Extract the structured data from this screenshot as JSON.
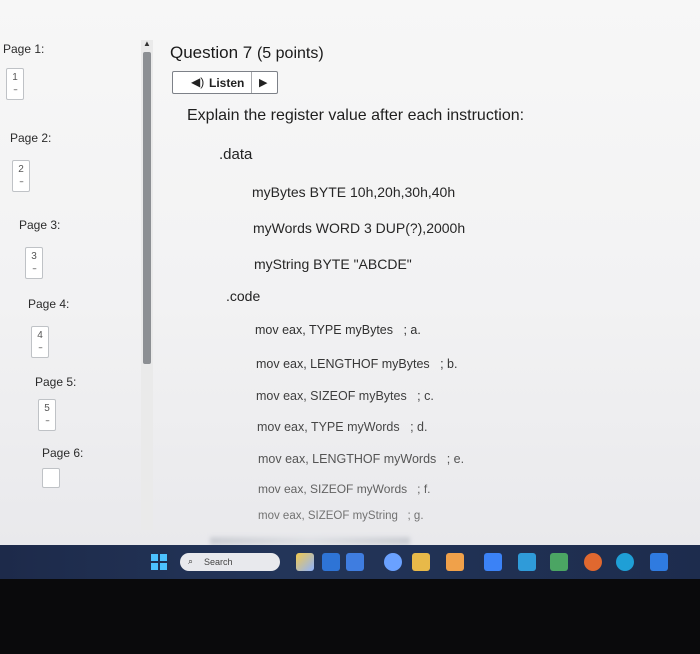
{
  "colors": {
    "accent": "#4cc2ff",
    "taskbar": "#1f2e50",
    "scrollbar_thumb": "#8c8f93"
  },
  "page_nav": {
    "pages": [
      {
        "label": "Page 1:",
        "number": "1",
        "marker": "--"
      },
      {
        "label": "Page 2:",
        "number": "2",
        "marker": "--"
      },
      {
        "label": "Page 3:",
        "number": "3",
        "marker": "--"
      },
      {
        "label": "Page 4:",
        "number": "4",
        "marker": "--"
      },
      {
        "label": "Page 5:",
        "number": "5",
        "marker": "--"
      },
      {
        "label": "Page 6:",
        "number": "",
        "marker": ""
      }
    ]
  },
  "question": {
    "title": "Question 7",
    "points": "(5 points)",
    "listen_label": "Listen",
    "instruction": "Explain the register value after each instruction:",
    "data_directive": ".data",
    "declarations": [
      "myBytes BYTE 10h,20h,30h,40h",
      "myWords WORD 3 DUP(?),2000h",
      "myString BYTE \"ABCDE\""
    ],
    "code_directive": ".code",
    "instructions": [
      {
        "text": "mov eax, TYPE myBytes",
        "comment": "; a."
      },
      {
        "text": "mov eax, LENGTHOF myBytes",
        "comment": "; b."
      },
      {
        "text": "mov eax, SIZEOF myBytes",
        "comment": "; c."
      },
      {
        "text": "mov eax, TYPE myWords",
        "comment": "; d."
      },
      {
        "text": "mov eax, LENGTHOF myWords",
        "comment": "; e."
      },
      {
        "text": "mov eax, SIZEOF myWords",
        "comment": "; f."
      },
      {
        "text": "mov eax, SIZEOF myString",
        "comment": "; g."
      }
    ]
  },
  "taskbar": {
    "search_placeholder": "Search",
    "icons": [
      "windows-start-icon",
      "weather-icon",
      "task-view-icon",
      "chat-icon",
      "file-explorer-icon",
      "store-icon",
      "app-icon",
      "word-icon",
      "mail-icon",
      "app-icon",
      "chrome-icon",
      "edge-icon",
      "app-icon"
    ]
  }
}
